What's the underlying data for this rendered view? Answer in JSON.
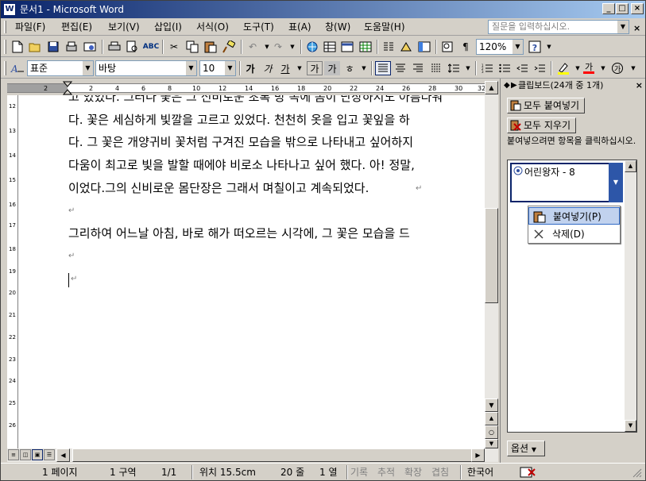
{
  "window": {
    "title": "문서1 - Microsoft Word",
    "icon_glyph": "W"
  },
  "menubar": {
    "items": [
      "파일(F)",
      "편집(E)",
      "보기(V)",
      "삽입(I)",
      "서식(O)",
      "도구(T)",
      "표(A)",
      "창(W)",
      "도움말(H)"
    ],
    "help_placeholder": "질문을 입력하십시오."
  },
  "toolbar": {
    "zoom": "120%",
    "style": "표준",
    "font": "바탕",
    "size": "10",
    "font_color_glyph": "가"
  },
  "ruler": {
    "top_numbers": [
      "2",
      "2",
      "4",
      "6",
      "8",
      "10",
      "12",
      "14",
      "16",
      "18",
      "20",
      "22",
      "24",
      "26",
      "28",
      "30",
      "32"
    ],
    "left_numbers": [
      "12",
      "13",
      "14",
      "15",
      "16",
      "17",
      "18",
      "19",
      "20",
      "21",
      "22",
      "23",
      "24",
      "25",
      "26"
    ]
  },
  "document": {
    "lines": [
      "고 있었다. 그러나 꽃은 그 신비로운 초록 방 속에 몸이 단장하지도 아름다워",
      "다. 꽃은 세심하게 빛깔을 고르고 있었다. 천천히 옷을 입고 꽃잎을 하",
      "다. 그 꽃은 개양귀비 꽃처럼 구겨진 모습을 밖으로 나타내고 싶어하지",
      "다움이 최고로 빛을 발할 때에야 비로소 나타나고 싶어 했다. 아! 정말,",
      "이었다.그의 신비로운 몸단장은 그래서 며칠이고 계속되었다."
    ],
    "paragraph2": "그리하여 어느날 아침, 바로 해가 떠오르는 시각에, 그 꽃은 모습을 드",
    "para_mark": "↵"
  },
  "taskpane": {
    "title": "클립보드(24개 중 1개)",
    "paste_all": "모두 붙여넣기",
    "clear_all": "모두 지우기",
    "hint": "붙여넣으려면 항목을 클릭하십시오.",
    "clip_item": "어린왕자 - 8",
    "options": "옵션"
  },
  "context_menu": {
    "paste": "붙여넣기(P)",
    "delete": "삭제(D)"
  },
  "statusbar": {
    "page": "1 페이지",
    "section": "1 구역",
    "pages": "1/1",
    "position": "위치 15.5cm",
    "line": "20 줄",
    "column": "1 열",
    "rec": "기록",
    "trk": "추적",
    "ext": "확장",
    "ovr": "겹침",
    "lang": "한국어"
  }
}
